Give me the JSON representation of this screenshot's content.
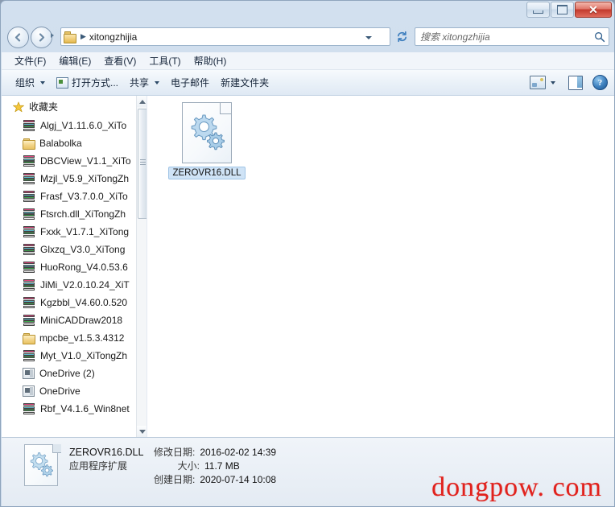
{
  "window": {
    "controls": {
      "minimize": "—",
      "maximize": "❐",
      "close": "✕"
    }
  },
  "address": {
    "back_label": "back",
    "forward_label": "forward",
    "folder_icon": "folder-icon",
    "breadcrumb_separator": "▶",
    "path": "xitongzhijia",
    "dropdown": "▾",
    "refresh_icon": "refresh-icon"
  },
  "search": {
    "placeholder": "搜索 xitongzhijia",
    "value": "",
    "icon": "search-icon"
  },
  "menu": {
    "items": [
      {
        "label": "文件(F)"
      },
      {
        "label": "编辑(E)"
      },
      {
        "label": "查看(V)"
      },
      {
        "label": "工具(T)"
      },
      {
        "label": "帮助(H)"
      }
    ]
  },
  "toolbar": {
    "organize": "组织",
    "open_with": "打开方式...",
    "share": "共享",
    "email": "电子邮件",
    "new_folder": "新建文件夹",
    "caret": "▾",
    "views_icon": "change-view-icon",
    "preview_icon": "preview-pane-icon",
    "help_icon": "help-icon",
    "help_glyph": "?"
  },
  "sidebar": {
    "header": "收藏夹",
    "header_icon": "star-icon",
    "items": [
      {
        "label": "Algj_V1.11.6.0_XiTo",
        "icon": "archive-icon"
      },
      {
        "label": "Balabolka",
        "icon": "folder-icon"
      },
      {
        "label": "DBCView_V1.1_XiTo",
        "icon": "archive-icon"
      },
      {
        "label": "Mzjl_V5.9_XiTongZh",
        "icon": "archive-icon"
      },
      {
        "label": "Frasf_V3.7.0.0_XiTo",
        "icon": "archive-icon"
      },
      {
        "label": "Ftsrch.dll_XiTongZh",
        "icon": "archive-icon"
      },
      {
        "label": "Fxxk_V1.7.1_XiTong",
        "icon": "archive-icon"
      },
      {
        "label": "Glxzq_V3.0_XiTong",
        "icon": "archive-icon"
      },
      {
        "label": "HuoRong_V4.0.53.6",
        "icon": "archive-icon"
      },
      {
        "label": "JiMi_V2.0.10.24_XiT",
        "icon": "archive-icon"
      },
      {
        "label": "Kgzbbl_V4.60.0.520",
        "icon": "archive-icon"
      },
      {
        "label": "MiniCADDraw2018",
        "icon": "archive-icon"
      },
      {
        "label": "mpcbe_v1.5.3.4312",
        "icon": "folder-icon"
      },
      {
        "label": "Myt_V1.0_XiTongZh",
        "icon": "archive-icon"
      },
      {
        "label": "OneDrive (2)",
        "icon": "onedrive-icon"
      },
      {
        "label": "OneDrive",
        "icon": "onedrive-icon"
      },
      {
        "label": "Rbf_V4.1.6_Win8net",
        "icon": "archive-icon"
      }
    ],
    "scrollbar": {
      "up_arrow": "▲",
      "down_arrow": "▼"
    }
  },
  "files": [
    {
      "name": "ZEROVR16.DLL",
      "icon": "dll-file-icon",
      "selected": true
    }
  ],
  "details": {
    "icon": "dll-file-icon",
    "file_name": "ZEROVR16.DLL",
    "file_type": "应用程序扩展",
    "modified_label": "修改日期:",
    "modified_value": "2016-02-02 14:39",
    "size_label": "大小:",
    "size_value": "11.7 MB",
    "created_label": "创建日期:",
    "created_value": "2020-07-14 10:08"
  },
  "watermark": {
    "text": "dongpow. com",
    "color": "#e1221d"
  }
}
